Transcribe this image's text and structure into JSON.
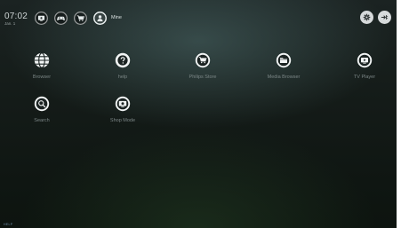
{
  "status": {
    "time": "07:02",
    "date": "Jan. 1"
  },
  "categories": [
    {
      "name": "tv",
      "icon": "tv-icon",
      "active": false
    },
    {
      "name": "games",
      "icon": "gamepad-icon",
      "active": false
    },
    {
      "name": "store",
      "icon": "cart-icon",
      "active": false
    },
    {
      "name": "mine",
      "icon": "user-icon",
      "active": true,
      "label": "Mine"
    }
  ],
  "apps": [
    {
      "label": "Browser",
      "icon": "globe-icon"
    },
    {
      "label": "help",
      "icon": "help-icon"
    },
    {
      "label": "Philips Store",
      "icon": "cart-icon"
    },
    {
      "label": "Media Browser",
      "icon": "folder-icon"
    },
    {
      "label": "TV Player",
      "icon": "tv-icon"
    },
    {
      "label": "Search",
      "icon": "search-icon"
    },
    {
      "label": "Shop Mode",
      "icon": "shop-tv-icon"
    }
  ],
  "footer": {
    "help_hint": "HELP"
  },
  "colors": {
    "accent_hint": "#6f8ea8",
    "button_bg": "#d6dadb"
  }
}
